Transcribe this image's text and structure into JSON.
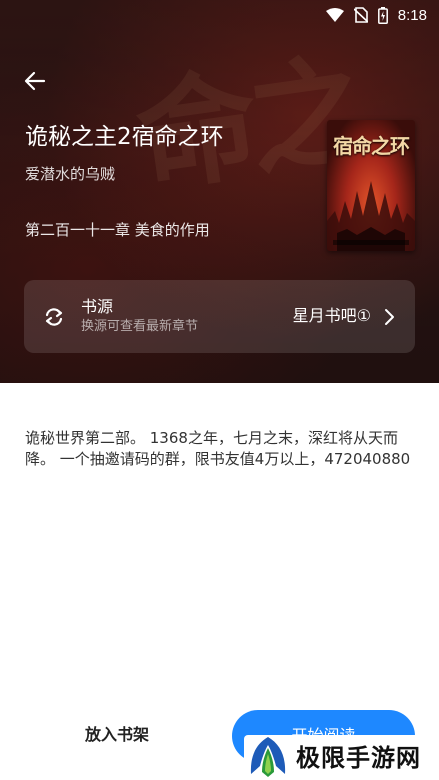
{
  "status_bar": {
    "time": "8:18"
  },
  "book": {
    "title": "诡秘之主2宿命之环",
    "author": "爱潜水的乌贼",
    "latest_chapter": "第二百一十一章 美食的作用",
    "cover_title": "宿命之环"
  },
  "source": {
    "label": "书源",
    "hint": "换源可查看最新章节",
    "value": "星月书吧①"
  },
  "description": "诡秘世界第二部。 1368之年，七月之末，深红将从天而降。 一个抽邀请码的群，限书友值4万以上，472040880",
  "actions": {
    "add_to_shelf": "放入书架",
    "start_reading": "开始阅读"
  },
  "watermark": {
    "text": "极限手游网"
  },
  "colors": {
    "accent": "#1e88ff",
    "hero_bg": "#2b1413"
  }
}
